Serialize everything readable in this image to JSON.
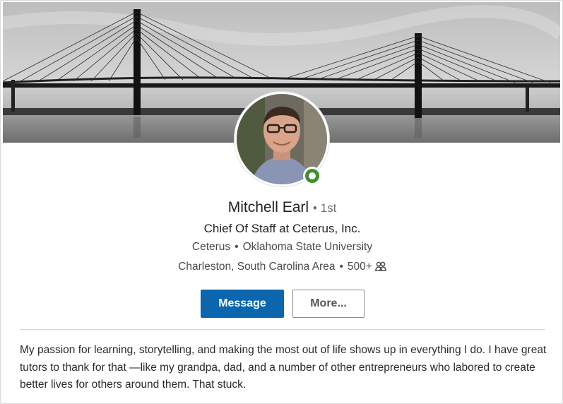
{
  "profile": {
    "name": "Mitchell Earl",
    "degree": "1st",
    "headline": "Chief Of Staff at Ceterus, Inc.",
    "company": "Ceterus",
    "school": "Oklahoma State University",
    "location": "Charleston, South Carolina Area",
    "connections": "500+",
    "online": true
  },
  "actions": {
    "message_label": "Message",
    "more_label": "More..."
  },
  "about": {
    "text": "My passion for learning, storytelling, and making the most out of life shows up in everything I do. I have great tutors to thank for that —like my grandpa, dad, and a number of other entrepreneurs who labored to create better lives for others around them. That stuck."
  },
  "colors": {
    "primary": "#0b66ad",
    "online": "#3f8f2e"
  },
  "icons": {
    "connections": "people-icon",
    "status": "online-status-icon"
  }
}
